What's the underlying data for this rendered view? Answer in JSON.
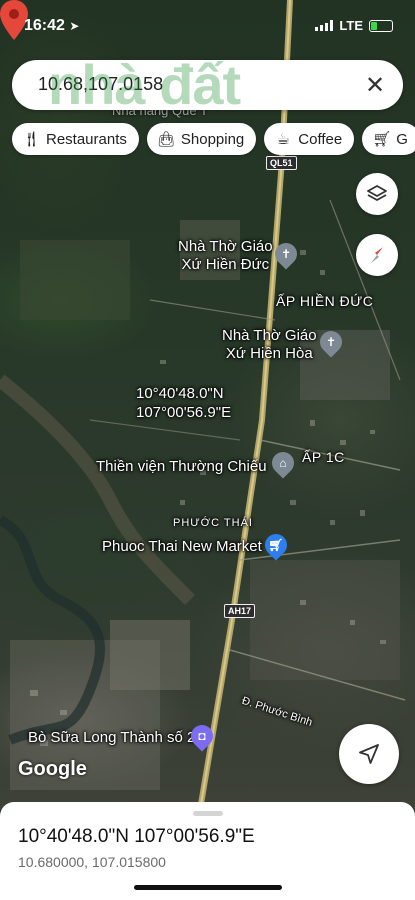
{
  "status_bar": {
    "time": "16:42",
    "network": "LTE"
  },
  "search": {
    "query": "10.68,107.0158",
    "watermark": "nhà đất"
  },
  "chips": [
    {
      "label": "Restaurants",
      "icon": "restaurant-icon"
    },
    {
      "label": "Shopping",
      "icon": "shopping-bag-icon"
    },
    {
      "label": "Coffee",
      "icon": "coffee-icon"
    },
    {
      "label": "G",
      "icon": "cart-icon"
    }
  ],
  "map": {
    "road_shield_top": "QL51",
    "road_shield_mid": "AH17",
    "labels": {
      "church1_line1": "Nhà Thờ Giáo",
      "church1_line2": "Xứ Hiền Đức",
      "ap_hien_duc": "ẤP HIỀN ĐỨC",
      "church2_line1": "Nhà Thờ Giáo",
      "church2_line2": "Xứ Hiền Hòa",
      "pin_lat": "10°40'48.0\"N",
      "pin_lng": "107°00'56.9\"E",
      "thien_vien": "Thiền viện Thường Chiếu",
      "ap_1c": "ẤP 1C",
      "phuoc_thai": "PHƯỚC THÁI",
      "market": "Phuoc Thai New Market",
      "phuoc_binh": "Đ. Phước Bình",
      "bo_sua": "Bò Sữa Long Thành số 2",
      "faded_top": "Nhà hàng Quê T"
    }
  },
  "brand": "Google",
  "sheet": {
    "title": "10°40'48.0\"N 107°00'56.9\"E",
    "subtitle": "10.680000, 107.015800"
  }
}
